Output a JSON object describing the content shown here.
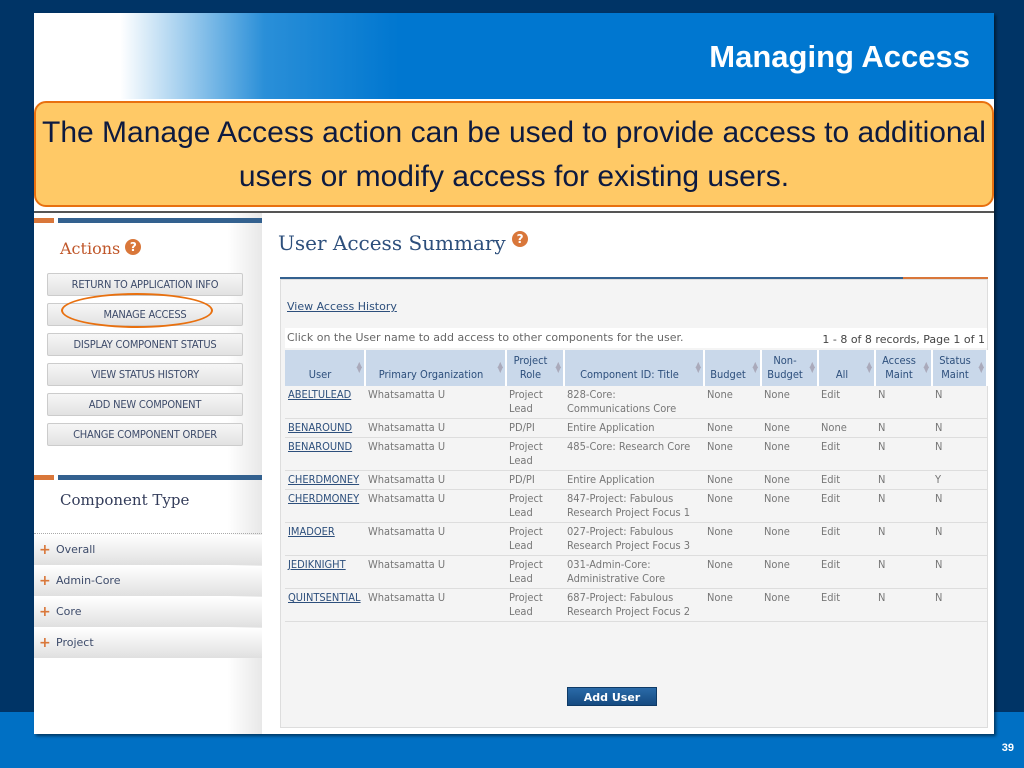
{
  "slide": {
    "title": "Managing Access",
    "callout": "The Manage Access action can be used to provide access to additional users or modify access for existing users.",
    "page_number": "39"
  },
  "sidebar": {
    "actions_heading": "Actions",
    "help": "?",
    "buttons": [
      "RETURN TO APPLICATION INFO",
      "MANAGE ACCESS",
      "DISPLAY COMPONENT STATUS",
      "VIEW STATUS HISTORY",
      "ADD NEW COMPONENT",
      "CHANGE COMPONENT ORDER"
    ],
    "component_type_heading": "Component Type",
    "categories": [
      "Overall",
      "Admin-Core",
      "Core",
      "Project"
    ],
    "plus": "+"
  },
  "main": {
    "heading": "User Access Summary",
    "help": "?",
    "view_history": "View Access History",
    "instructions": "Click on the User name to add access to other components for the user.",
    "records": "1 - 8 of 8 records, Page 1 of 1",
    "add_user": "Add User",
    "columns": [
      "User",
      "Primary Organization",
      "Project Role",
      "Component ID: Title",
      "Budget",
      "Non-Budget",
      "All",
      "Access Maint",
      "Status Maint"
    ],
    "rows": [
      [
        "ABELTULEAD",
        "Whatsamatta U",
        "Project Lead",
        "828-Core: Communications Core",
        "None",
        "None",
        "Edit",
        "N",
        "N"
      ],
      [
        "BENAROUND",
        "Whatsamatta U",
        "PD/PI",
        "Entire Application",
        "None",
        "None",
        "None",
        "N",
        "N"
      ],
      [
        "BENAROUND",
        "Whatsamatta U",
        "Project Lead",
        "485-Core: Research Core",
        "None",
        "None",
        "Edit",
        "N",
        "N"
      ],
      [
        "CHERDMONEY",
        "Whatsamatta U",
        "PD/PI",
        "Entire Application",
        "None",
        "None",
        "Edit",
        "N",
        "Y"
      ],
      [
        "CHERDMONEY",
        "Whatsamatta U",
        "Project Lead",
        "847-Project: Fabulous Research Project Focus 1",
        "None",
        "None",
        "Edit",
        "N",
        "N"
      ],
      [
        "IMADOER",
        "Whatsamatta U",
        "Project Lead",
        "027-Project: Fabulous Research Project Focus 3",
        "None",
        "None",
        "Edit",
        "N",
        "N"
      ],
      [
        "JEDIKNIGHT",
        "Whatsamatta U",
        "Project Lead",
        "031-Admin-Core: Administrative Core",
        "None",
        "None",
        "Edit",
        "N",
        "N"
      ],
      [
        "QUINTSENTIAL",
        "Whatsamatta U",
        "Project Lead",
        "687-Project: Fabulous Research Project Focus 2",
        "None",
        "None",
        "Edit",
        "N",
        "N"
      ]
    ]
  }
}
